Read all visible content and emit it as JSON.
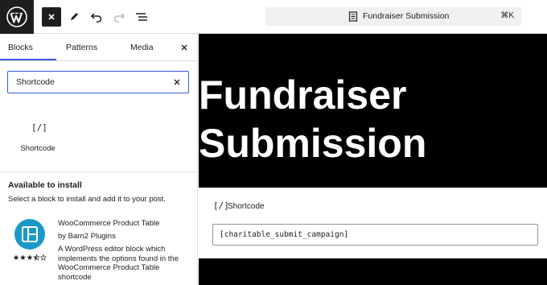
{
  "toolbar": {
    "document_title": "Fundraiser Submission",
    "command_shortcut": "⌘K"
  },
  "inserter": {
    "tabs": [
      {
        "label": "Blocks",
        "active": true
      },
      {
        "label": "Patterns",
        "active": false
      },
      {
        "label": "Media",
        "active": false
      }
    ],
    "search": {
      "value": "Shortcode"
    },
    "result": {
      "icon_text": "[/]",
      "label": "Shortcode"
    },
    "available": {
      "title": "Available to install",
      "description": "Select a block to install and add it to your post.",
      "plugin": {
        "name": "WooCommerce Product Table",
        "author": "by Barn2 Plugins",
        "description": "A WordPress editor block which implements the options found in the WooCommerce Product Table shortcode",
        "rating": 3.5,
        "rating_max": 5,
        "icon_color": "#1a98c7"
      }
    }
  },
  "canvas": {
    "title_line1": "Fundraiser",
    "title_line2": "Submission",
    "shortcode_block": {
      "icon_text": "[/]",
      "label": "Shortcode",
      "value": "[charitable_submit_campaign]"
    }
  },
  "colors": {
    "accent": "#3858e9",
    "dark": "#1e1e1e",
    "canvas_bg": "#000000"
  }
}
